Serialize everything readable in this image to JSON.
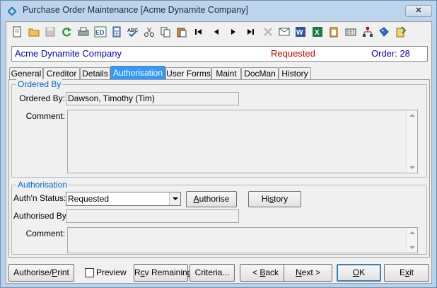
{
  "window": {
    "title": "Purchase Order Maintenance",
    "company_bracket": "[Acme Dynamite Company]",
    "close_symbol": "✕"
  },
  "toolbar": {
    "icons": [
      "new-document-icon",
      "open-folder-icon",
      "save-icon",
      "refresh-icon",
      "print-icon",
      "edit-icon",
      "calculator-icon",
      "spell-check-icon",
      "cut-icon",
      "copy-icon",
      "paste-icon",
      "first-record-icon",
      "previous-record-icon",
      "next-record-icon",
      "last-record-icon",
      "delete-icon",
      "email-icon",
      "word-icon",
      "excel-icon",
      "clipboard-icon",
      "keyboard-icon",
      "hierarchy-icon",
      "tag-icon",
      "notes-icon"
    ]
  },
  "infobar": {
    "company": "Acme Dynamite Company",
    "status": "Requested",
    "order": "Order: 28",
    "colors": {
      "company": "#0000c8",
      "status": "#d00000"
    }
  },
  "tabs": [
    "General",
    "Creditor",
    "Details",
    "Authorisation",
    "User Forms",
    "Maint",
    "DocMan",
    "History"
  ],
  "active_tab": "Authorisation",
  "ordered_by": {
    "group_title": "Ordered By",
    "ordered_by_label": "Ordered By:",
    "ordered_by_value": "Dawson, Timothy (Tim)",
    "comment_label": "Comment:",
    "comment_value": ""
  },
  "authorisation": {
    "group_title": "Authorisation",
    "status_label": "Auth'n Status:",
    "status_value": "Requested",
    "authorise_pre": "",
    "authorise_key": "A",
    "authorise_post": "uthorise",
    "history_pre": "Hi",
    "history_key": "s",
    "history_post": "tory",
    "authorised_by_label": "Authorised By:",
    "authorised_by_value": "",
    "comment_label": "Comment:",
    "comment_value": ""
  },
  "buttons": {
    "authorise_print_pre": "Authorise/",
    "authorise_print_key": "P",
    "authorise_print_post": "rint",
    "preview_label": "Preview",
    "preview_key": "v",
    "rcv_remaining_pre": "R",
    "rcv_remaining_key": "c",
    "rcv_remaining_post": "v Remaining.",
    "criteria_pre": "Criteria",
    "criteria_post": "...",
    "back_pre": "< ",
    "back_key": "B",
    "back_post": "ack",
    "next_key": "N",
    "next_post": "ext >",
    "ok_key": "O",
    "ok_post": "K",
    "exit_pre": "E",
    "exit_key": "x",
    "exit_post": "it"
  }
}
